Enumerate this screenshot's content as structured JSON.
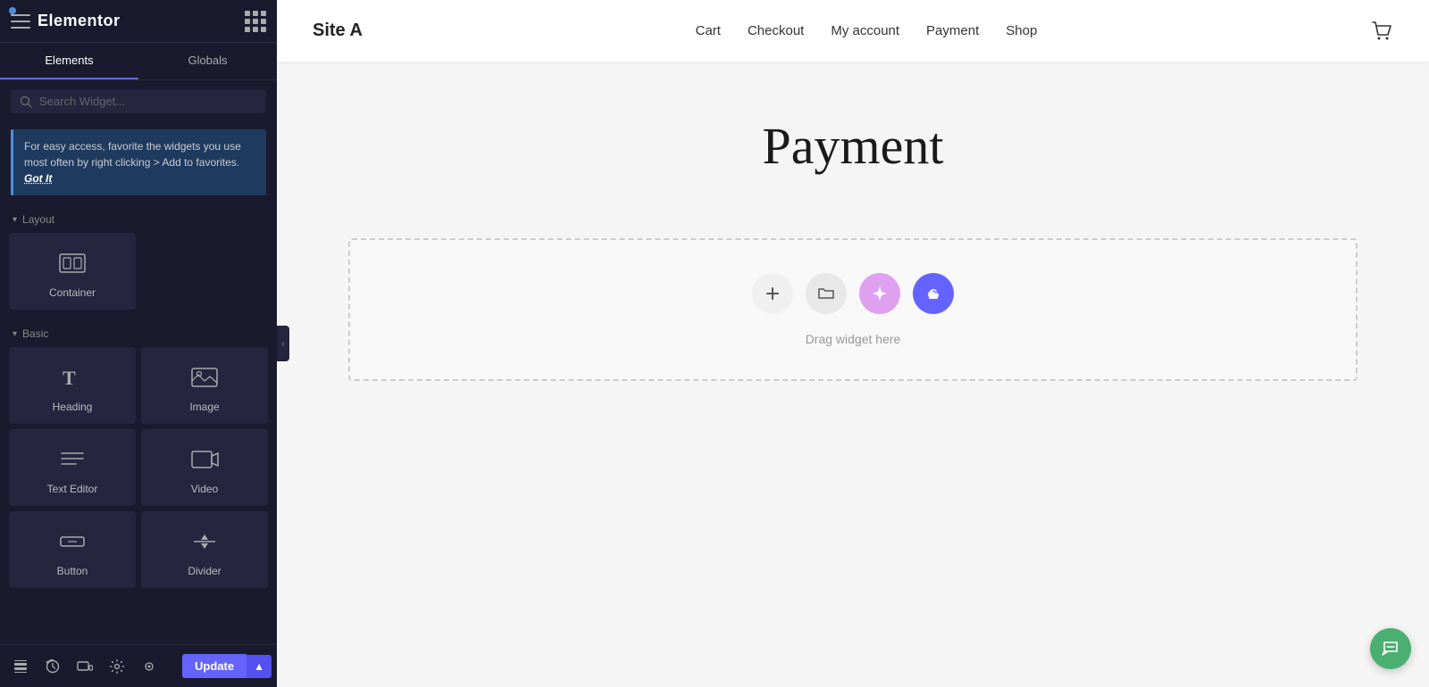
{
  "app": {
    "name": "Elementor",
    "dot_color": "#4a90d9"
  },
  "left_panel": {
    "tabs": [
      {
        "label": "Elements",
        "active": true
      },
      {
        "label": "Globals",
        "active": false
      }
    ],
    "search": {
      "placeholder": "Search Widget..."
    },
    "info_banner": {
      "text": "For easy access, favorite the widgets you use most often by right clicking > Add to favorites.",
      "cta": "Got It"
    },
    "sections": [
      {
        "id": "layout",
        "label": "Layout",
        "widgets": [
          {
            "id": "container",
            "label": "Container"
          }
        ]
      },
      {
        "id": "basic",
        "label": "Basic",
        "widgets": [
          {
            "id": "heading",
            "label": "Heading"
          },
          {
            "id": "image",
            "label": "Image"
          },
          {
            "id": "text-editor",
            "label": "Text Editor"
          },
          {
            "id": "video",
            "label": "Video"
          },
          {
            "id": "button",
            "label": "Button"
          },
          {
            "id": "divider",
            "label": "Divider"
          }
        ]
      }
    ]
  },
  "bottom_toolbar": {
    "tools": [
      {
        "id": "layers",
        "icon": "layers"
      },
      {
        "id": "history",
        "icon": "history"
      },
      {
        "id": "responsive",
        "icon": "responsive"
      },
      {
        "id": "settings",
        "icon": "settings"
      },
      {
        "id": "preview",
        "icon": "preview"
      }
    ],
    "update_label": "Update"
  },
  "site": {
    "logo": "Site A",
    "nav_links": [
      "Cart",
      "Checkout",
      "My account",
      "Payment",
      "Shop"
    ],
    "page_title": "Payment"
  },
  "canvas": {
    "drop_zone_text": "Drag widget here"
  }
}
